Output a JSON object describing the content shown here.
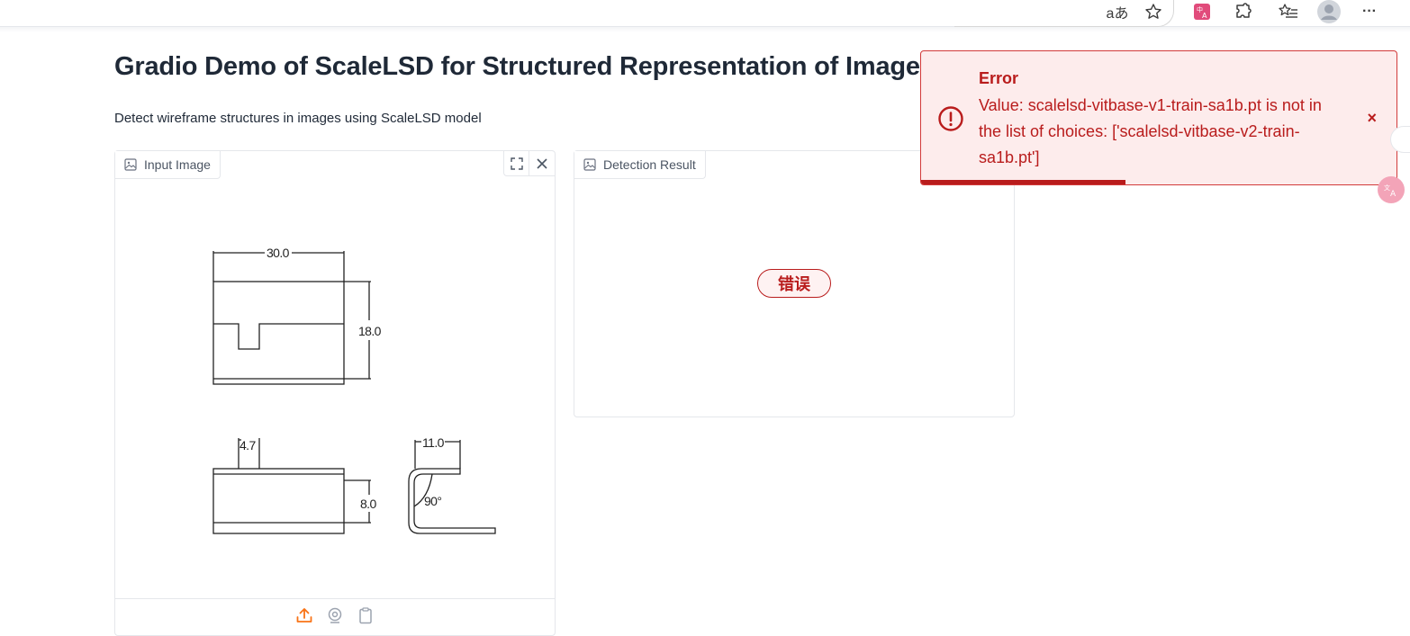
{
  "browser": {
    "toolbar_icons": [
      "read-aloud-icon",
      "favorite-star-icon",
      "translate-extension-icon",
      "extensions-puzzle-icon",
      "favorites-list-icon",
      "profile-avatar-icon",
      "more-menu-icon"
    ],
    "read_aloud_glyph": "aあ",
    "more_glyph": "···"
  },
  "page": {
    "title": "Gradio Demo of ScaleLSD for Structured Representation of Image",
    "description": "Detect wireframe structures in images using ScaleLSD model"
  },
  "input_panel": {
    "label": "Input Image",
    "sources": [
      "upload-icon",
      "webcam-icon",
      "clipboard-icon"
    ],
    "drawing": {
      "dims": {
        "width_top": "30.0",
        "height_right": "18.0",
        "notch_width": "4.7",
        "height_lower": "8.0",
        "side_width": "11.0",
        "angle": "90°"
      }
    }
  },
  "output_panel": {
    "label": "Detection Result",
    "status": "错误"
  },
  "toast": {
    "title": "Error",
    "message": "Value: scalelsd-vitbase-v1-train-sa1b.pt is not in the list of choices: ['scalelsd-vitbase-v2-train-sa1b.pt']",
    "close_glyph": "×",
    "progress": 0.43
  },
  "colors": {
    "error": "#b91c1c",
    "error_bg": "#fdecec",
    "accent_orange": "#f97316"
  }
}
